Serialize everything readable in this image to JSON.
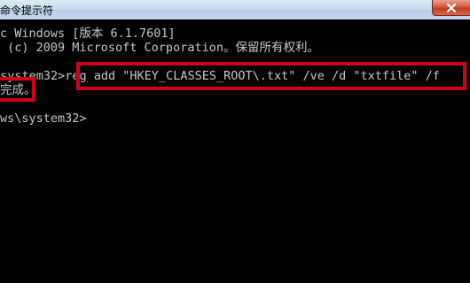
{
  "window": {
    "title": "命令提示符",
    "close_icon": "close-x-icon"
  },
  "console": {
    "lines": [
      "c Windows [版本 6.1.7601]",
      " (c) 2009 Microsoft Corporation。保留所有权利。",
      "",
      "\\system32>reg add \"HKEY_CLASSES_ROOT\\.txt\" /ve /d \"txtfile\" /f",
      "完成。",
      "",
      "ws\\system32>"
    ]
  },
  "annotations": {
    "color": "#d0001a"
  }
}
